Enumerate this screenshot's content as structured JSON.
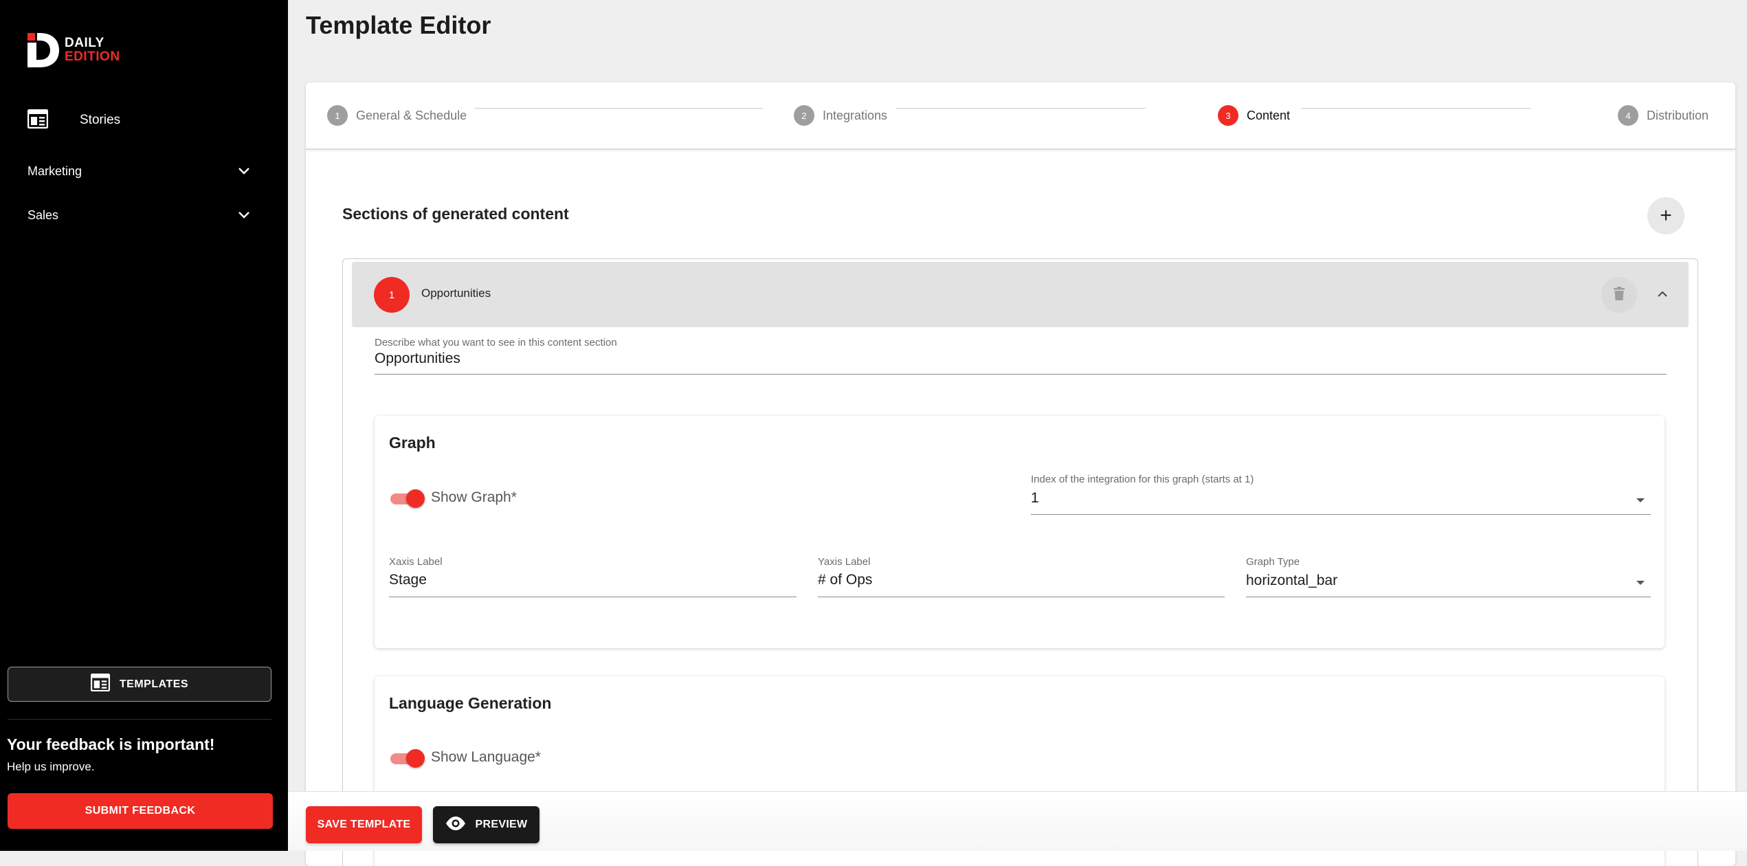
{
  "brand": {
    "line1": "DAILY",
    "line2": "EDITION",
    "accent": "#ef2b24"
  },
  "sidebar": {
    "stories_label": "Stories",
    "groups": [
      {
        "label": "Marketing"
      },
      {
        "label": "Sales"
      }
    ],
    "templates_button": "TEMPLATES",
    "feedback_title": "Your feedback is important!",
    "feedback_subtitle": "Help us improve.",
    "feedback_button": "SUBMIT FEEDBACK"
  },
  "page": {
    "title": "Template Editor"
  },
  "stepper": {
    "steps": [
      {
        "num": "1",
        "label": "General & Schedule",
        "active": false
      },
      {
        "num": "2",
        "label": "Integrations",
        "active": false
      },
      {
        "num": "3",
        "label": "Content",
        "active": true
      },
      {
        "num": "4",
        "label": "Distribution",
        "active": false
      }
    ]
  },
  "content": {
    "sections_title": "Sections of generated content",
    "add_symbol": "+",
    "section": {
      "num": "1",
      "name": "Opportunities",
      "describe_label": "Describe what you want to see in this content section",
      "describe_value": "Opportunities"
    },
    "graph": {
      "title": "Graph",
      "show_label": "Show Graph*",
      "show_on": true,
      "index_label": "Index of the integration for this graph (starts at 1)",
      "index_value": "1",
      "xaxis_label": "Xaxis Label",
      "xaxis_value": "Stage",
      "yaxis_label": "Yaxis Label",
      "yaxis_value": "# of Ops",
      "type_label": "Graph Type",
      "type_value": "horizontal_bar"
    },
    "language": {
      "title": "Language Generation",
      "show_label": "Show Language*",
      "show_on": true
    }
  },
  "actions": {
    "save_label": "SAVE TEMPLATE",
    "preview_label": "PREVIEW"
  }
}
